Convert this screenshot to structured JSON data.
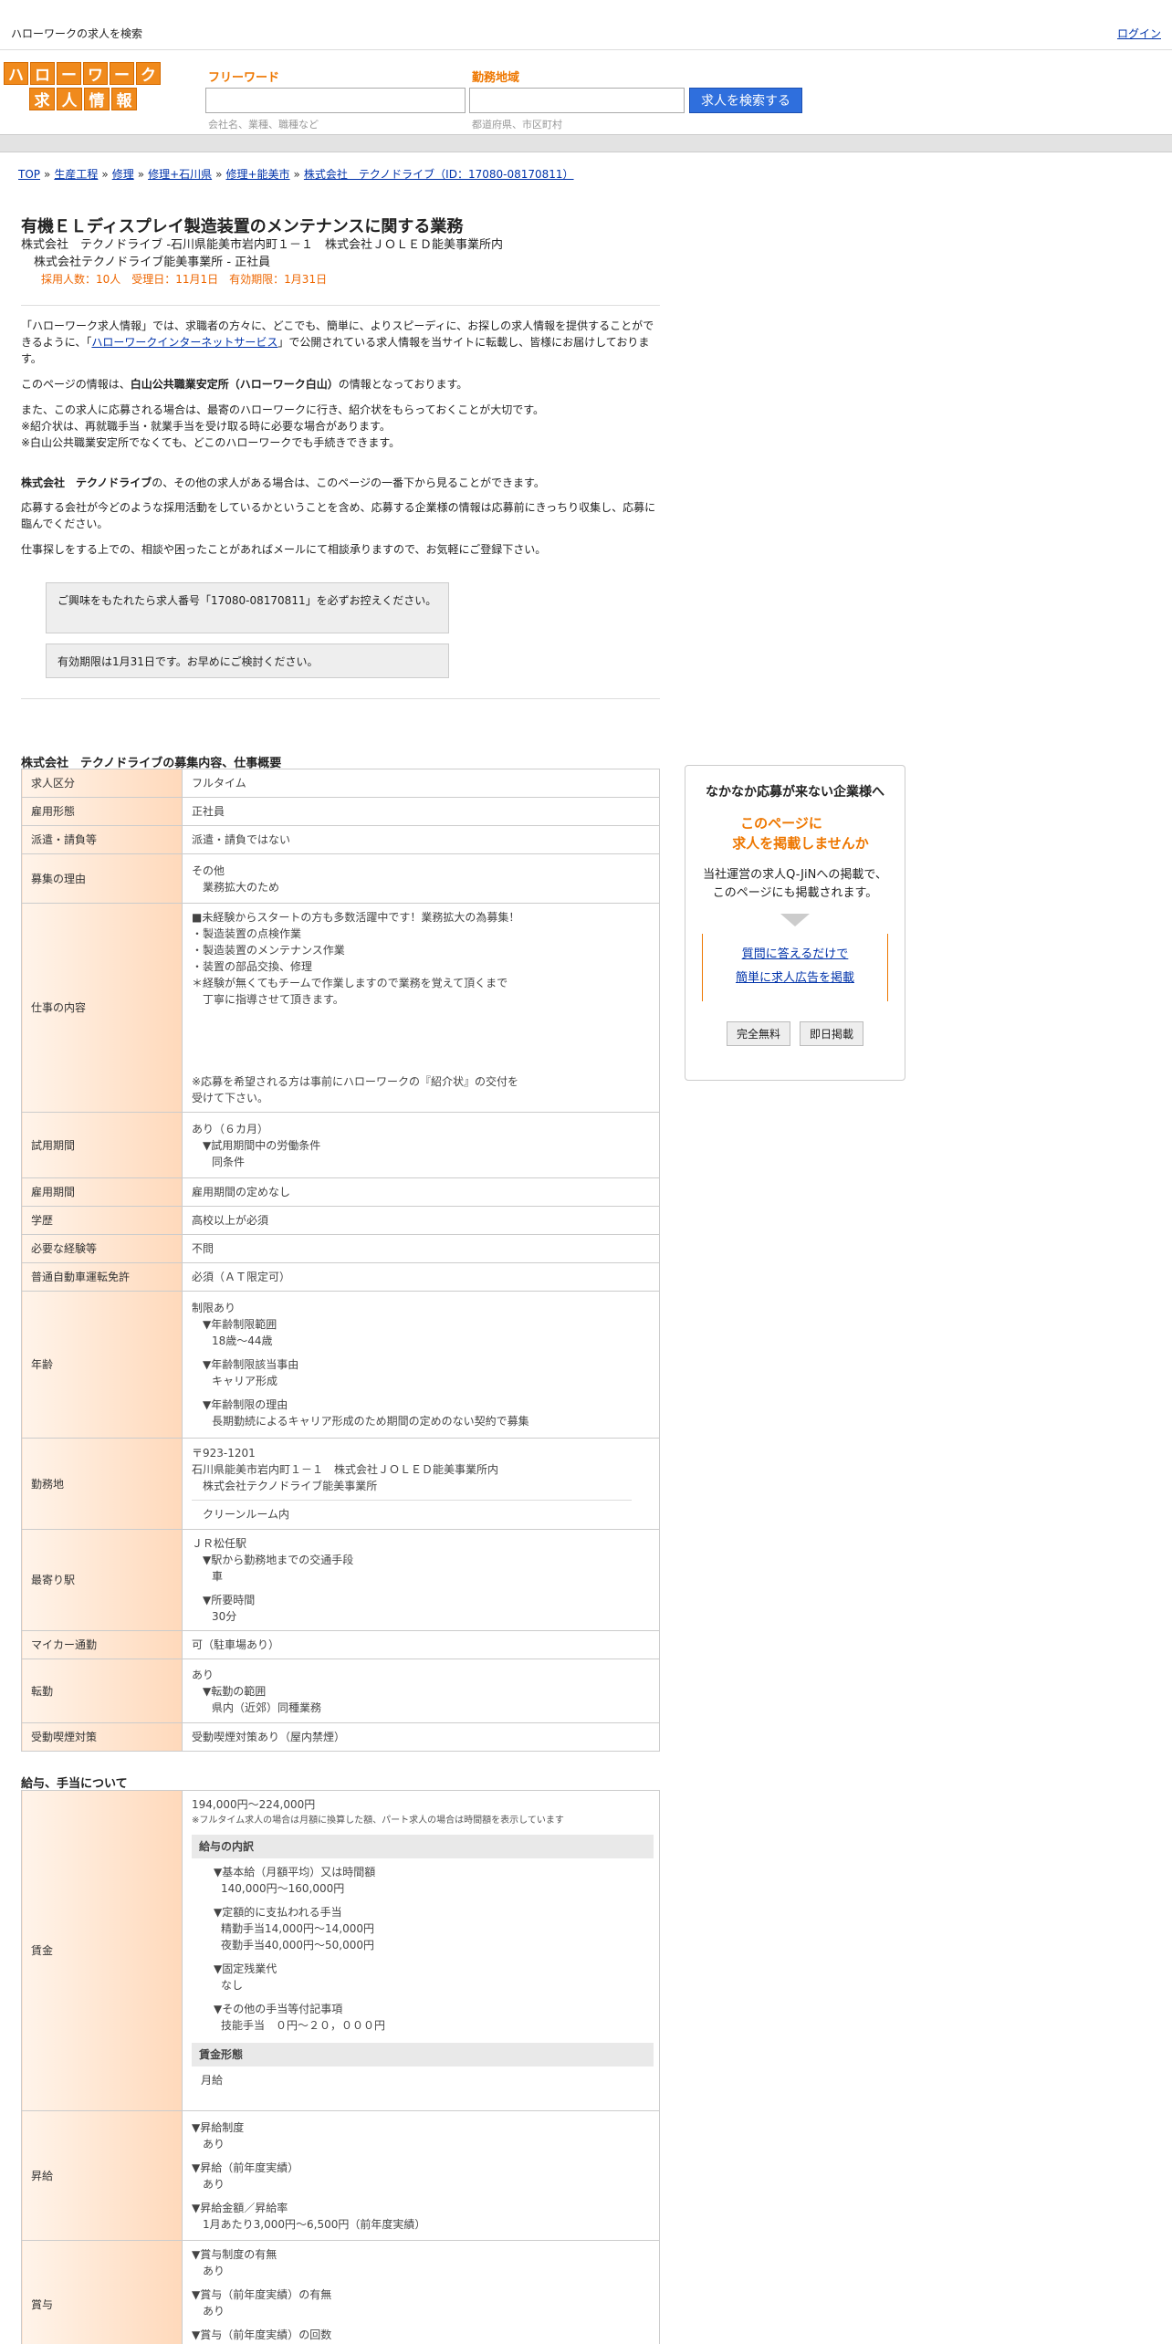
{
  "top": {
    "title": "ハローワークの求人を検索",
    "login": "ログイン"
  },
  "logo": {
    "row1": [
      "ハ",
      "ロ",
      "ー",
      "ワ",
      "ー",
      "ク"
    ],
    "row2": [
      "求",
      "人",
      "情",
      "報"
    ]
  },
  "search": {
    "freeword_label": "フリーワード",
    "freeword_hint": "会社名、業種、職種など",
    "area_label": "勤務地域",
    "area_hint": "都道府県、市区町村",
    "button": "求人を検索する"
  },
  "breadcrumb": [
    "TOP",
    "生産工程",
    "修理",
    "修理+石川県",
    "修理+能美市",
    "株式会社　テクノドライブ（ID：17080-08170811）"
  ],
  "job": {
    "title": "有機ＥＬディスプレイ製造装置のメンテナンスに関する業務",
    "line1": "株式会社　テクノドライブ -石川県能美市岩内町１－１　株式会社ＪＯＬＥＤ能美事業所内",
    "line2": "株式会社テクノドライブ能美事業所 - 正社員",
    "line3": "採用人数：10人　受理日：11月1日　有効期限：1月31日"
  },
  "intro": {
    "p1a": "「ハローワーク求人情報」では、求職者の方々に、どこでも、簡単に、よりスピーディに、お探しの求人情報を提供することができるように、「",
    "p1link": "ハローワークインターネットサービス",
    "p1b": "」で公開されている求人情報を当サイトに転載し、皆様にお届けしております。",
    "p2a": "このページの情報は、",
    "p2b": "白山公共職業安定所（ハローワーク白山）",
    "p2c": "の情報となっております。",
    "p3": [
      "また、この求人に応募される場合は、最寄のハローワークに行き、紹介状をもらっておくことが大切です。",
      "※紹介状は、再就職手当・就業手当を受け取る時に必要な場合があります。",
      "※白山公共職業安定所でなくても、どこのハローワークでも手続きできます。"
    ],
    "p4a": "株式会社　テクノドライブ",
    "p4b": "の、その他の求人がある場合は、このページの一番下から見ることができます。",
    "p5": "応募する会社が今どのような採用活動をしているかということを含め、応募する企業様の情報は応募前にきっちり収集し、応募に臨んでください。",
    "p6": "仕事探しをする上での、相談や困ったことがあればメールにて相談承りますので、お気軽にご登録下さい。",
    "notice1": "ご興味をもたれたら求人番号「17080-08170811」を必ずお控えください。",
    "notice2": "有効期限は1月31日です。お早めにご検討ください。"
  },
  "section1": "株式会社　テクノドライブの募集内容、仕事概要",
  "rows": {
    "r1": {
      "h": "求人区分",
      "v": "フルタイム"
    },
    "r2": {
      "h": "雇用形態",
      "v": "正社員"
    },
    "r3": {
      "h": "派遣・請負等",
      "v": "派遣・請負ではない"
    },
    "r4": {
      "h": "募集の理由",
      "v1": "その他",
      "v2": "業務拡大のため"
    },
    "r5": {
      "h": "仕事の内容",
      "lines": [
        "■未経験からスタートの方も多数活躍中です！業務拡大の為募集！",
        "・製造装置の点検作業",
        "・製造装置のメンテナンス作業",
        "・装置の部品交換、修理",
        "＊経験が無くてもチームで作業しますので業務を覚えて頂くまで",
        "　丁寧に指導させて頂きます。"
      ],
      "note1": "※応募を希望される方は事前にハローワークの『紹介状』の交付を",
      "note2": "受けて下さい。"
    },
    "r6": {
      "h": "試用期間",
      "v1": "あり（６カ月）",
      "v2": "▼試用期間中の労働条件",
      "v3": "同条件"
    },
    "r7": {
      "h": "雇用期間",
      "v": "雇用期間の定めなし"
    },
    "r8": {
      "h": "学歴",
      "v": "高校以上が必須"
    },
    "r9": {
      "h": "必要な経験等",
      "v": "不問"
    },
    "r10": {
      "h": "普通自動車運転免許",
      "v": "必須（ＡＴ限定可）"
    },
    "r11": {
      "h": "年齢",
      "v1": "制限あり",
      "v2": "▼年齢制限範囲",
      "v3": "18歳〜44歳",
      "v4": "▼年齢制限該当事由",
      "v5": "キャリア形成",
      "v6": "▼年齢制限の理由",
      "v7": "長期勤続によるキャリア形成のため期間の定めのない契約で募集"
    },
    "r12": {
      "h": "勤務地",
      "v1": "〒923-1201",
      "v2": "石川県能美市岩内町１－１　株式会社ＪＯＬＥＤ能美事業所内",
      "v3": "株式会社テクノドライブ能美事業所",
      "v4": "クリーンルーム内"
    },
    "r13": {
      "h": "最寄り駅",
      "v1": "ＪＲ松任駅",
      "v2": "▼駅から勤務地までの交通手段",
      "v3": "車",
      "v4": "▼所要時間",
      "v5": "30分"
    },
    "r14": {
      "h": "マイカー通勤",
      "v": "可（駐車場あり）"
    },
    "r15": {
      "h": "転勤",
      "v1": "あり",
      "v2": "▼転勤の範囲",
      "v3": "県内（近郊）同種業務"
    },
    "r16": {
      "h": "受動喫煙対策",
      "v": "受動喫煙対策あり（屋内禁煙）"
    }
  },
  "section2": "給与、手当について",
  "pay": {
    "h1": "賃金",
    "range": "194,000円〜224,000円",
    "note": "※フルタイム求人の場合は月額に換算した額、パート求人の場合は時間額を表示しています",
    "sub1": "給与の内訳",
    "b1": "▼基本給（月額平均）又は時間額",
    "b1v": "140,000円〜160,000円",
    "b2": "▼定額的に支払われる手当",
    "b2v1": "精勤手当14,000円〜14,000円",
    "b2v2": "夜勤手当40,000円〜50,000円",
    "b3": "▼固定残業代",
    "b3v": "なし",
    "b4": "▼その他の手当等付記事項",
    "b4v": "技能手当　０円～２０，０００円",
    "sub2": "賃金形態",
    "sub2v": "月給",
    "h2": "昇給",
    "c1": "▼昇給制度",
    "c1v": "あり",
    "c2": "▼昇給（前年度実績）",
    "c2v": "あり",
    "c3": "▼昇給金額／昇給率",
    "c3v": "1月あたり3,000円〜6,500円（前年度実績）",
    "h3": "賞与",
    "d1": "▼賞与制度の有無",
    "d1v": "あり",
    "d2": "▼賞与（前年度実績）の有無",
    "d2v": "あり",
    "d3": "▼賞与（前年度実績）の回数"
  },
  "ad": {
    "title": "なかなか応募が来ない企業様へ",
    "em1": "このページに",
    "em2": "求人を掲載しませんか",
    "text1": "当社運営の求人Q-JiNへの掲載で、",
    "text2": "このページにも掲載されます。",
    "link1": "質問に答えるだけで",
    "link2": "簡単に求人広告を掲載",
    "btn1": "完全無料",
    "btn2": "即日掲載"
  }
}
